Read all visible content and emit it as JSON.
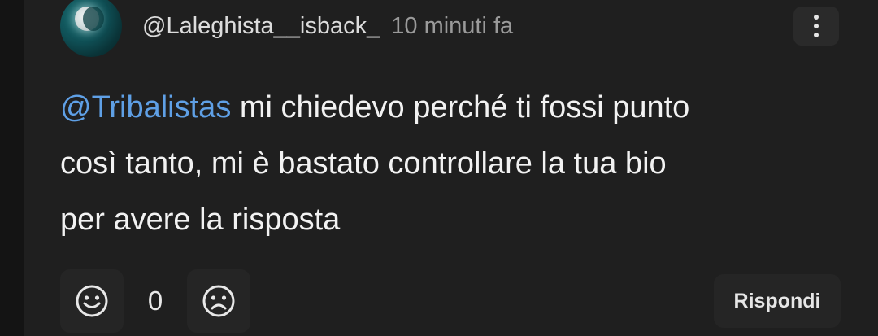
{
  "comment": {
    "author": "@Laleghista__isback_",
    "timestamp": "10 minuti fa",
    "mention": "@Tribalistas",
    "text_line1": " mi chiedevo perché ti fossi punto",
    "text_line2": "così tanto, mi è bastato controllare la tua bio",
    "text_line3": "per avere la risposta"
  },
  "actions": {
    "like_icon": "smile-icon",
    "count": "0",
    "dislike_icon": "frown-icon",
    "reply_label": "Rispondi"
  },
  "menu": {
    "icon": "more-vertical-icon"
  },
  "colors": {
    "background": "#141414",
    "card": "#1f1f1f",
    "mention": "#5fa0e6",
    "text": "#f2f2f2",
    "muted": "#9a9a9a"
  }
}
